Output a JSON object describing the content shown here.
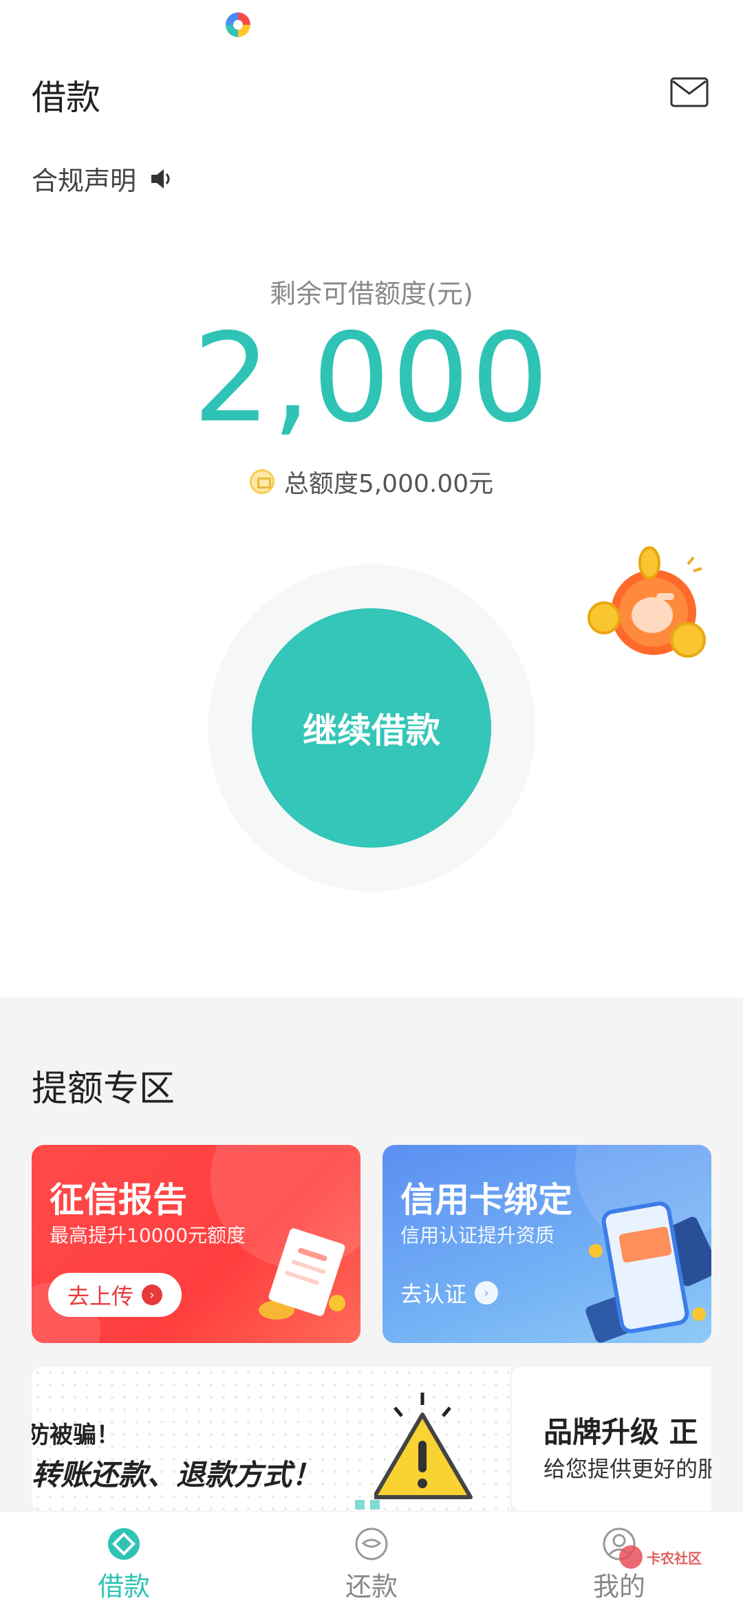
{
  "header": {
    "title": "借款"
  },
  "compliance": {
    "label": "合规声明"
  },
  "credit": {
    "label": "剩余可借额度(元)",
    "amount": "2,000",
    "total": "总额度5,000.00元"
  },
  "action": {
    "label": "继续借款"
  },
  "boost": {
    "title": "提额专区",
    "cards": [
      {
        "title": "征信报告",
        "subtitle": "最高提升10000元额度",
        "cta": "去上传"
      },
      {
        "title": "信用卡绑定",
        "subtitle": "信用认证提升资质",
        "cta": "去认证"
      }
    ]
  },
  "banners": [
    {
      "line1": "防被骗！",
      "line2": "转账还款、退款方式！"
    },
    {
      "title": "品牌升级 正",
      "subtitle": "给您提供更好的服"
    }
  ],
  "tabs": [
    {
      "label": "借款",
      "icon": "loan-icon",
      "active": true
    },
    {
      "label": "还款",
      "icon": "repay-icon",
      "active": false
    },
    {
      "label": "我的",
      "icon": "profile-icon",
      "active": false
    }
  ],
  "watermark": {
    "text": "卡农社区"
  },
  "colors": {
    "accent": "#2fc3b5",
    "red_card": "#ff4a4a",
    "blue_card": "#5b8ff2"
  }
}
